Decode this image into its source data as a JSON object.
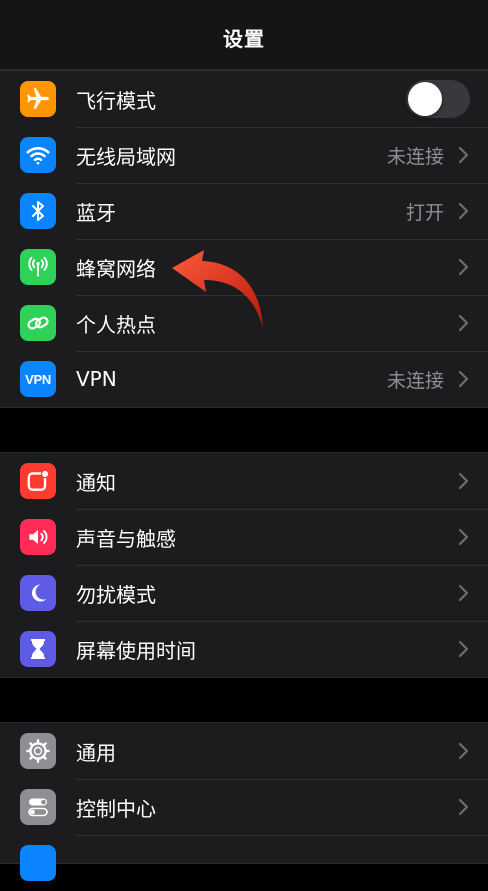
{
  "header": {
    "title": "设置"
  },
  "groups": [
    {
      "items": [
        {
          "label": "飞行模式",
          "value": "",
          "icon": "airplane-icon",
          "color": "#ff9500",
          "toggle": true,
          "toggle_on": false
        },
        {
          "label": "无线局域网",
          "value": "未连接",
          "icon": "wifi-icon",
          "color": "#0a84ff"
        },
        {
          "label": "蓝牙",
          "value": "打开",
          "icon": "bluetooth-icon",
          "color": "#0a84ff"
        },
        {
          "label": "蜂窝网络",
          "value": "",
          "icon": "cellular-antenna-icon",
          "color": "#30d158"
        },
        {
          "label": "个人热点",
          "value": "",
          "icon": "hotspot-chain-icon",
          "color": "#30d158"
        },
        {
          "label": "VPN",
          "value": "未连接",
          "icon": "vpn-icon",
          "icon_text": "VPN",
          "color": "#0a84ff"
        }
      ]
    },
    {
      "items": [
        {
          "label": "通知",
          "icon": "notification-icon",
          "color": "#ff3b30"
        },
        {
          "label": "声音与触感",
          "icon": "speaker-icon",
          "color": "#ff2d55"
        },
        {
          "label": "勿扰模式",
          "icon": "moon-icon",
          "color": "#5e5ce6"
        },
        {
          "label": "屏幕使用时间",
          "icon": "hourglass-icon",
          "color": "#5e5ce6"
        }
      ]
    },
    {
      "items": [
        {
          "label": "通用",
          "icon": "gear-icon",
          "color": "#8e8e93"
        },
        {
          "label": "控制中心",
          "icon": "control-center-icon",
          "color": "#8e8e93"
        }
      ]
    }
  ],
  "annotation": {
    "icon": "red-curved-arrow-icon",
    "color": "#e5321e"
  }
}
